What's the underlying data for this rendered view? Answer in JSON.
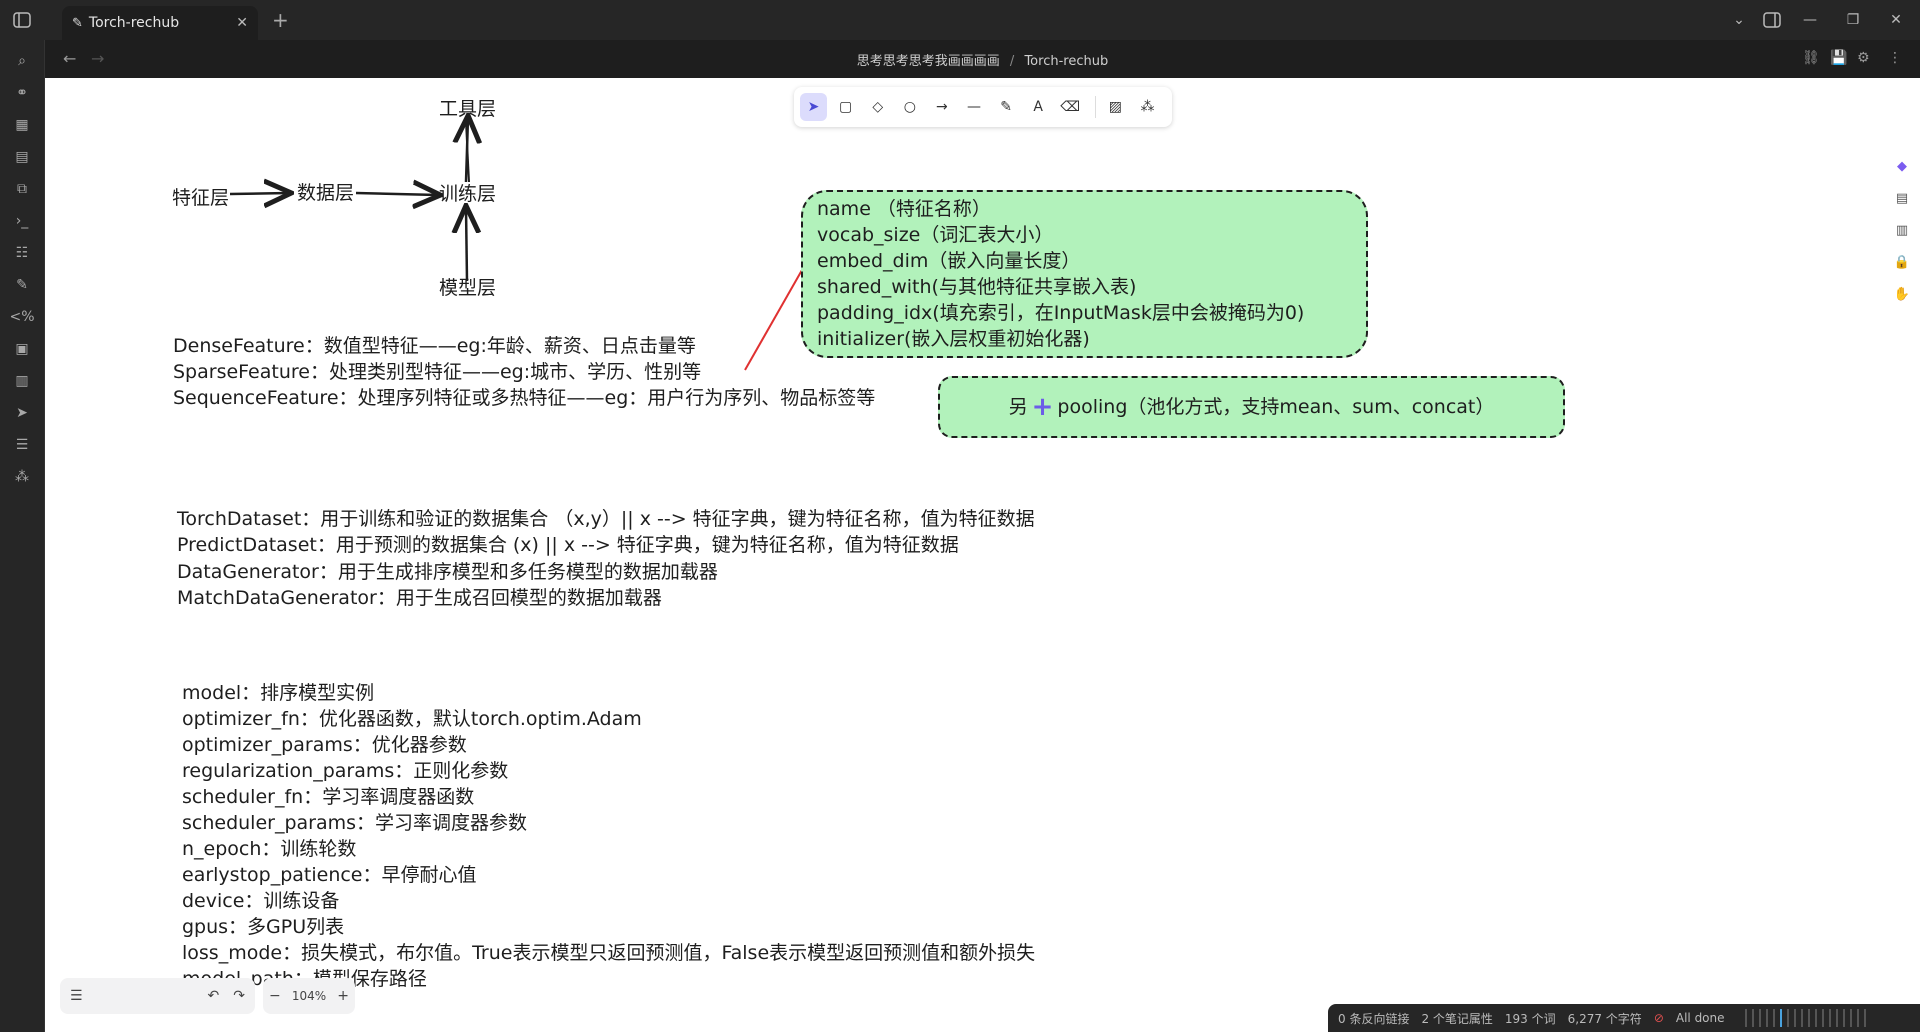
{
  "window": {
    "tab_title": "Torch-rechub",
    "new_tab": "+"
  },
  "breadcrumb": {
    "folder": "思考思考思考我画画画画",
    "separator": "/",
    "file": "Torch-rechub"
  },
  "diagram": {
    "nodes": {
      "tool_layer": "工具层",
      "feature_layer": "特征层",
      "data_layer": "数据层",
      "train_layer": "训练层",
      "model_layer": "模型层"
    },
    "features": [
      "DenseFeature：数值型特征——eg:年龄、薪资、日点击量等",
      "SparseFeature：处理类别型特征——eg:城市、学历、性别等",
      "SequenceFeature：处理序列特征或多热特征——eg：用户行为序列、物品标签等"
    ],
    "note1": [
      "name （特征名称）",
      "vocab_size（词汇表大小）",
      "embed_dim（嵌入向量长度）",
      "shared_with(与其他特征共享嵌入表)",
      "padding_idx(填充索引，在InputMask层中会被掩码为0)",
      "initializer(嵌入层权重初始化器)"
    ],
    "note2_prefix": "另",
    "note2_text": "pooling（池化方式，支持mean、sum、concat）",
    "datasets": [
      "TorchDataset：用于训练和验证的数据集合 （x,y）|| x --> 特征字典，键为特征名称，值为特征数据",
      "PredictDataset：用于预测的数据集合 (x) || x --> 特征字典，键为特征名称，值为特征数据",
      "DataGenerator：用于生成排序模型和多任务模型的数据加载器",
      "MatchDataGenerator：用于生成召回模型的数据加载器"
    ],
    "trainer_params": [
      "model：排序模型实例",
      "optimizer_fn：优化器函数，默认torch.optim.Adam",
      "optimizer_params：优化器参数",
      "regularization_params：正则化参数",
      "scheduler_fn：学习率调度器函数",
      "scheduler_params：学习率调度器参数",
      "n_epoch：训练轮数",
      "earlystop_patience：早停耐心值",
      "device：训练设备",
      "gpus：多GPU列表",
      "loss_mode：损失模式，布尔值。True表示模型只返回预测值，False表示模型返回预测值和额外损失",
      "model_path：模型保存路径"
    ]
  },
  "toolbar": {
    "tools": [
      "selection-tool",
      "rectangle-tool",
      "diamond-tool",
      "ellipse-tool",
      "arrow-tool",
      "line-tool",
      "draw-tool",
      "text-tool",
      "eraser-tool",
      "image-tool",
      "library-tool"
    ]
  },
  "bottom_controls": {
    "zoom": "104%",
    "zoom_out": "−",
    "zoom_in": "+"
  },
  "statusbar": {
    "backlinks": "0 条反向链接",
    "properties": "2 个笔记属性",
    "words": "193 个词",
    "chars": "6,277 个字符",
    "sync": "All done"
  },
  "colors": {
    "note_fill": "#b2f2bb",
    "stroke": "#1e1e1e",
    "connector": "#e03131",
    "active_tool": "#dcdcfc"
  }
}
